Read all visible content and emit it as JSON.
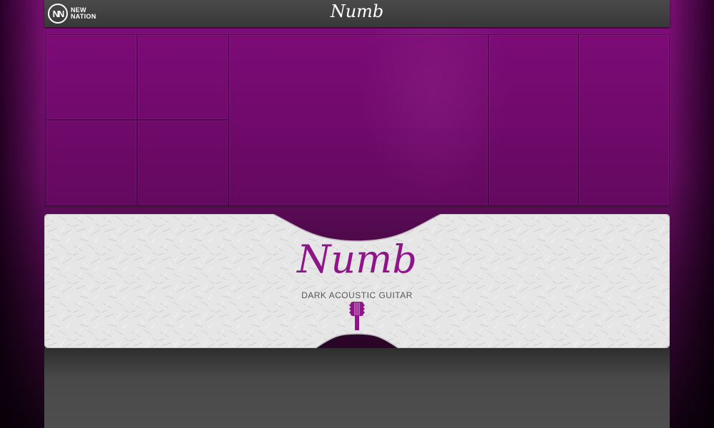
{
  "header": {
    "logo": {
      "line1": "NEW",
      "line2": "NATION",
      "badge": "NN",
      "icon": "new-nation-logo"
    },
    "title": "Numb"
  },
  "info": {
    "title": "Numb",
    "subtitle": "DARK ACOUSTIC GUITAR",
    "icon": "acoustic-guitar-icon"
  },
  "colors": {
    "accent": "#8e1487",
    "purple_bg": "#7a0f74",
    "header_bg": "#404040",
    "panel_white": "#e8e8e8"
  }
}
